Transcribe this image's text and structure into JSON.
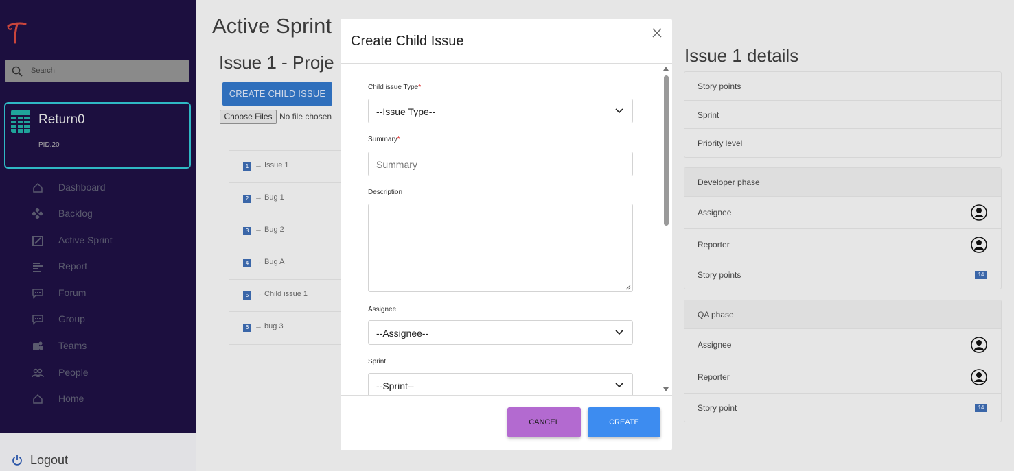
{
  "sidebar": {
    "search_placeholder": "Search",
    "project": {
      "name": "Return0",
      "id": "PID.20"
    },
    "items": [
      {
        "label": "Dashboard",
        "icon": "home-icon"
      },
      {
        "label": "Backlog",
        "icon": "diamond-grid-icon"
      },
      {
        "label": "Active Sprint",
        "icon": "sprint-icon"
      },
      {
        "label": "Report",
        "icon": "report-icon"
      },
      {
        "label": "Forum",
        "icon": "chat-icon"
      },
      {
        "label": "Group",
        "icon": "chat-icon"
      },
      {
        "label": "Teams",
        "icon": "teams-icon"
      },
      {
        "label": "People",
        "icon": "people-icon"
      },
      {
        "label": "Home",
        "icon": "home-icon"
      }
    ],
    "logout_label": "Logout"
  },
  "main": {
    "page_title": "Active Sprint",
    "sub_title": "Issue 1 - Proje",
    "create_child_label": "CREATE CHILD ISSUE",
    "choose_files_label": "Choose Files",
    "no_file_text": "No file chosen",
    "issues": [
      {
        "num": "1",
        "label": "→ Issue 1"
      },
      {
        "num": "2",
        "label": "→ Bug 1"
      },
      {
        "num": "3",
        "label": "→ Bug 2"
      },
      {
        "num": "4",
        "label": "→ Bug A"
      },
      {
        "num": "5",
        "label": "→ Child issue 1"
      },
      {
        "num": "6",
        "label": "→ bug 3"
      }
    ]
  },
  "details": {
    "title": "Issue 1 details",
    "general": [
      "Story points",
      "Sprint",
      "Priority level"
    ],
    "dev_phase": {
      "heading": "Developer phase",
      "assignee": "Assignee",
      "reporter": "Reporter",
      "story_points": "Story points",
      "story_points_value": "14"
    },
    "qa_phase": {
      "heading": "QA phase",
      "assignee": "Assignee",
      "reporter": "Reporter",
      "story_point": "Story point",
      "story_point_value": "14"
    }
  },
  "modal": {
    "title": "Create Child Issue",
    "type_label": "Child issue Type",
    "type_value": "--Issue Type--",
    "summary_label": "Summary",
    "summary_placeholder": "Summary",
    "description_label": "Description",
    "assignee_label": "Assignee",
    "assignee_value": "--Assignee--",
    "sprint_label": "Sprint",
    "sprint_value": "--Sprint--",
    "required_mark": "*",
    "cancel_label": "CANCEL",
    "create_label": "CREATE"
  }
}
